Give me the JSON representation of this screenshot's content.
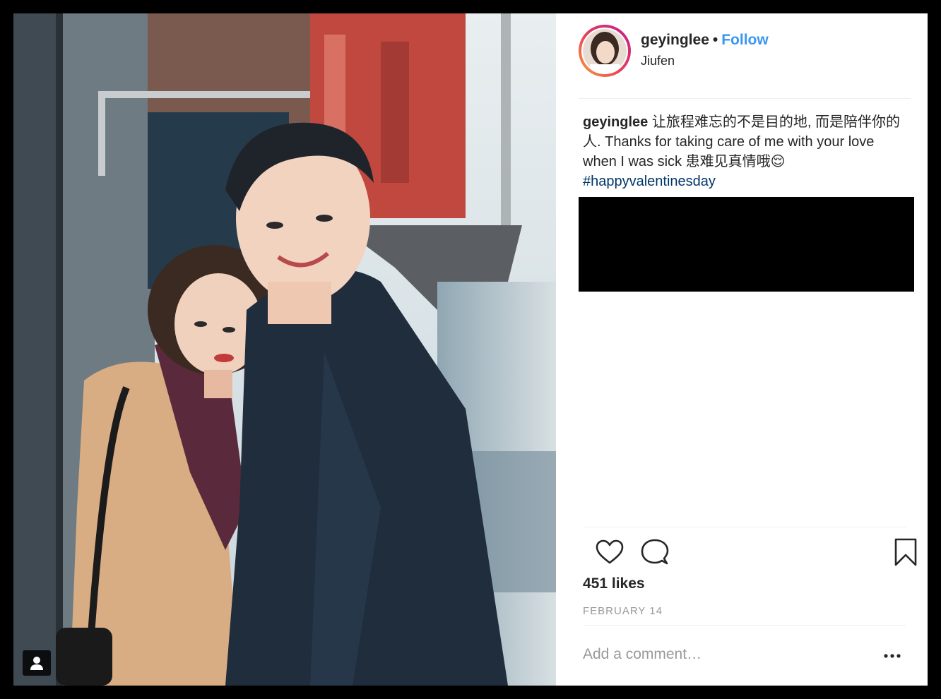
{
  "post": {
    "username": "geyinglee",
    "separator": "•",
    "follow_label": "Follow",
    "location": "Jiufen"
  },
  "caption": {
    "username": "geyinglee",
    "text": "让旅程难忘的不是目的地, 而是陪伴你的人. Thanks for taking care of me with your love when I was sick 患难见真情哦😌 ",
    "hashtag": "#happyvalentinesday"
  },
  "engagement": {
    "likes": "451 likes",
    "date": "FEBRUARY 14"
  },
  "comment": {
    "placeholder": "Add a comment…"
  },
  "icons": {
    "like": "heart-icon",
    "comment": "comment-bubble-icon",
    "save": "bookmark-icon",
    "more": "more-options-icon",
    "tagged_users": "user-tag-icon"
  },
  "colors": {
    "link_blue": "#3897f0",
    "hashtag_blue": "#003569",
    "text": "#262626",
    "muted": "#999999"
  }
}
